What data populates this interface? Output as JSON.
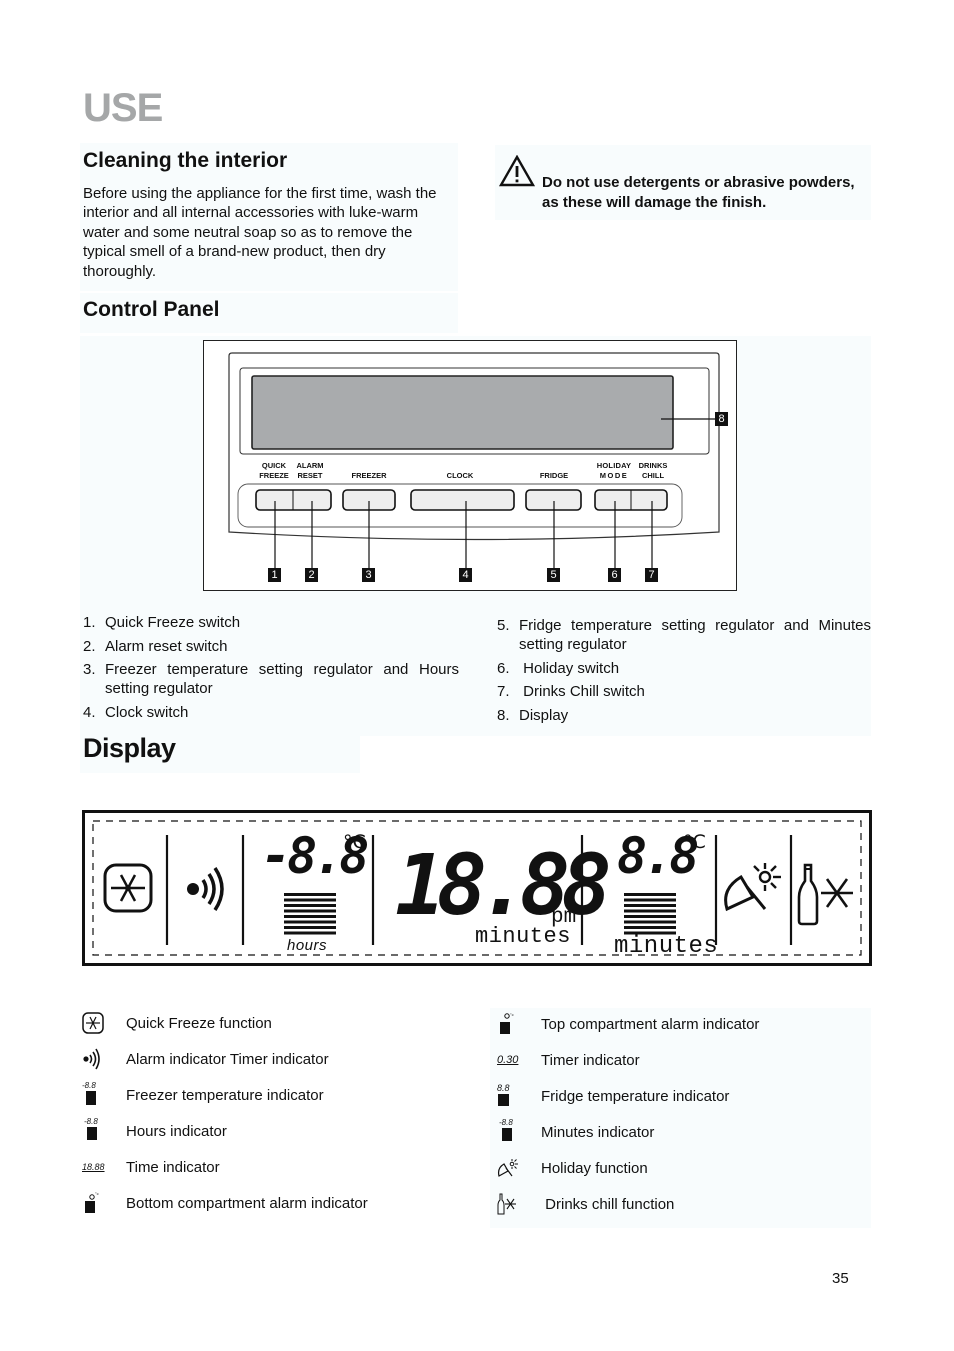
{
  "page": {
    "section_title": "USE",
    "page_number": "35"
  },
  "cleaning": {
    "heading": "Cleaning the interior",
    "body": "Before using the appliance for the first time, wash the interior and all internal accessories with luke-warm water and some neutral soap so as to remove the typical smell of a brand-new product, then dry thoroughly."
  },
  "warning": {
    "icon": "warning-triangle-icon",
    "text": "Do not use detergents or abrasive powders, as these will damage the finish."
  },
  "control_panel": {
    "heading": "Control Panel",
    "buttons": [
      {
        "label_line1": "QUICK",
        "label_line2": "FREEZE",
        "callout": "1"
      },
      {
        "label_line1": "ALARM",
        "label_line2": "RESET",
        "callout": "2"
      },
      {
        "label_line1": "",
        "label_line2": "FREEZER",
        "callout": "3"
      },
      {
        "label_line1": "",
        "label_line2": "CLOCK",
        "callout": "4"
      },
      {
        "label_line1": "",
        "label_line2": "FRIDGE",
        "callout": "5"
      },
      {
        "label_line1": "HOLIDAY",
        "label_line2": "MODE",
        "callout": "6"
      },
      {
        "label_line1": "DRINKS",
        "label_line2": "CHILL",
        "callout": "7"
      }
    ],
    "display_callout": "8",
    "items_left": [
      {
        "num": "1.",
        "text": "Quick Freeze switch"
      },
      {
        "num": "2.",
        "text": "Alarm reset switch"
      },
      {
        "num": "3.",
        "text": "Freezer temperature setting regulator and Hours setting regulator"
      },
      {
        "num": "4.",
        "text": "Clock switch"
      }
    ],
    "items_right": [
      {
        "num": "5.",
        "text": "Fridge temperature setting regulator and Minutes setting regulator"
      },
      {
        "num": "6.",
        "text": " Holiday switch"
      },
      {
        "num": "7.",
        "text": " Drinks Chill switch"
      },
      {
        "num": "8.",
        "text": "Display"
      }
    ]
  },
  "display": {
    "heading": "Display",
    "lcd": {
      "freezer_temp": "-8.8",
      "freezer_unit": "°C",
      "freezer_caption": "hours",
      "clock": "18.88",
      "clock_suffix": "pm",
      "clock_caption": "minutes",
      "fridge_temp": "8.8",
      "fridge_unit": "°C",
      "fridge_caption": "minutes"
    },
    "legend_left": [
      {
        "icon": "quick-freeze-icon",
        "text": "Quick Freeze function"
      },
      {
        "icon": "alarm-icon",
        "text": "Alarm indicator Timer indicator"
      },
      {
        "icon": "freezer-temperature-icon",
        "text": "Freezer temperature indicator"
      },
      {
        "icon": "hours-icon",
        "text": "Hours indicator"
      },
      {
        "icon": "time-icon",
        "text": "Time indicator"
      },
      {
        "icon": "bottom-compartment-alarm-icon",
        "text": "Bottom compartment alarm indicator"
      }
    ],
    "legend_right": [
      {
        "icon": "top-compartment-alarm-icon",
        "text": "Top compartment alarm indicator"
      },
      {
        "icon": "timer-icon",
        "text": "Timer indicator"
      },
      {
        "icon": "fridge-temperature-icon",
        "text": "Fridge temperature indicator"
      },
      {
        "icon": "minutes-icon",
        "text": "Minutes indicator"
      },
      {
        "icon": "holiday-icon",
        "text": "Holiday function"
      },
      {
        "icon": "drinks-chill-icon",
        "text": " Drinks chill function"
      }
    ],
    "icon_texts": {
      "freezer_mini": "-8.8",
      "hours_mini": "-8.8",
      "time_mini": "18.88",
      "timer_mini": "0.30",
      "fridge_mini": "8.8",
      "minutes_mini": "-8.8"
    }
  }
}
